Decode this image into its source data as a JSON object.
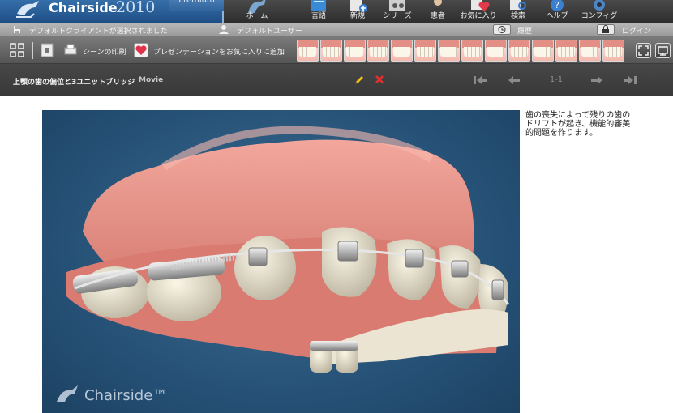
{
  "app": {
    "name": "Chairside",
    "year": "2010",
    "edition": "Premium"
  },
  "nav": {
    "items": [
      {
        "label": "ホーム",
        "icon": "home-icon"
      },
      {
        "label": "言語",
        "icon": "language-icon"
      },
      {
        "label": "新規",
        "icon": "new-icon"
      },
      {
        "label": "シリーズ",
        "icon": "series-icon"
      },
      {
        "label": "患者",
        "icon": "patient-icon"
      },
      {
        "label": "お気に入り",
        "icon": "favorites-icon"
      },
      {
        "label": "検索",
        "icon": "search-icon"
      },
      {
        "label": "ヘルプ",
        "icon": "help-icon"
      },
      {
        "label": "コンフィグ",
        "icon": "config-icon"
      }
    ]
  },
  "status": {
    "client": "デフォルトクライアントが選択されました",
    "user": "デフォルトユーザー",
    "history": "履歴",
    "login": "ログイン"
  },
  "toolbar": {
    "print": "シーンの印刷",
    "add_favorite": "プレゼンテーションをお気に入りに追加",
    "thumbnail_count": 14
  },
  "scene": {
    "title": "上顎の歯の偏位と3ユニットブリッジ",
    "media_type": "Movie",
    "pager": "1-1",
    "description": "歯の喪失によって残りの歯のドリフトが起き、機能的審美的問題を作ります。"
  },
  "colors": {
    "brand_blue": "#2a5f99",
    "scene_bg": "#2b5a80",
    "gum": "#e48f86"
  }
}
